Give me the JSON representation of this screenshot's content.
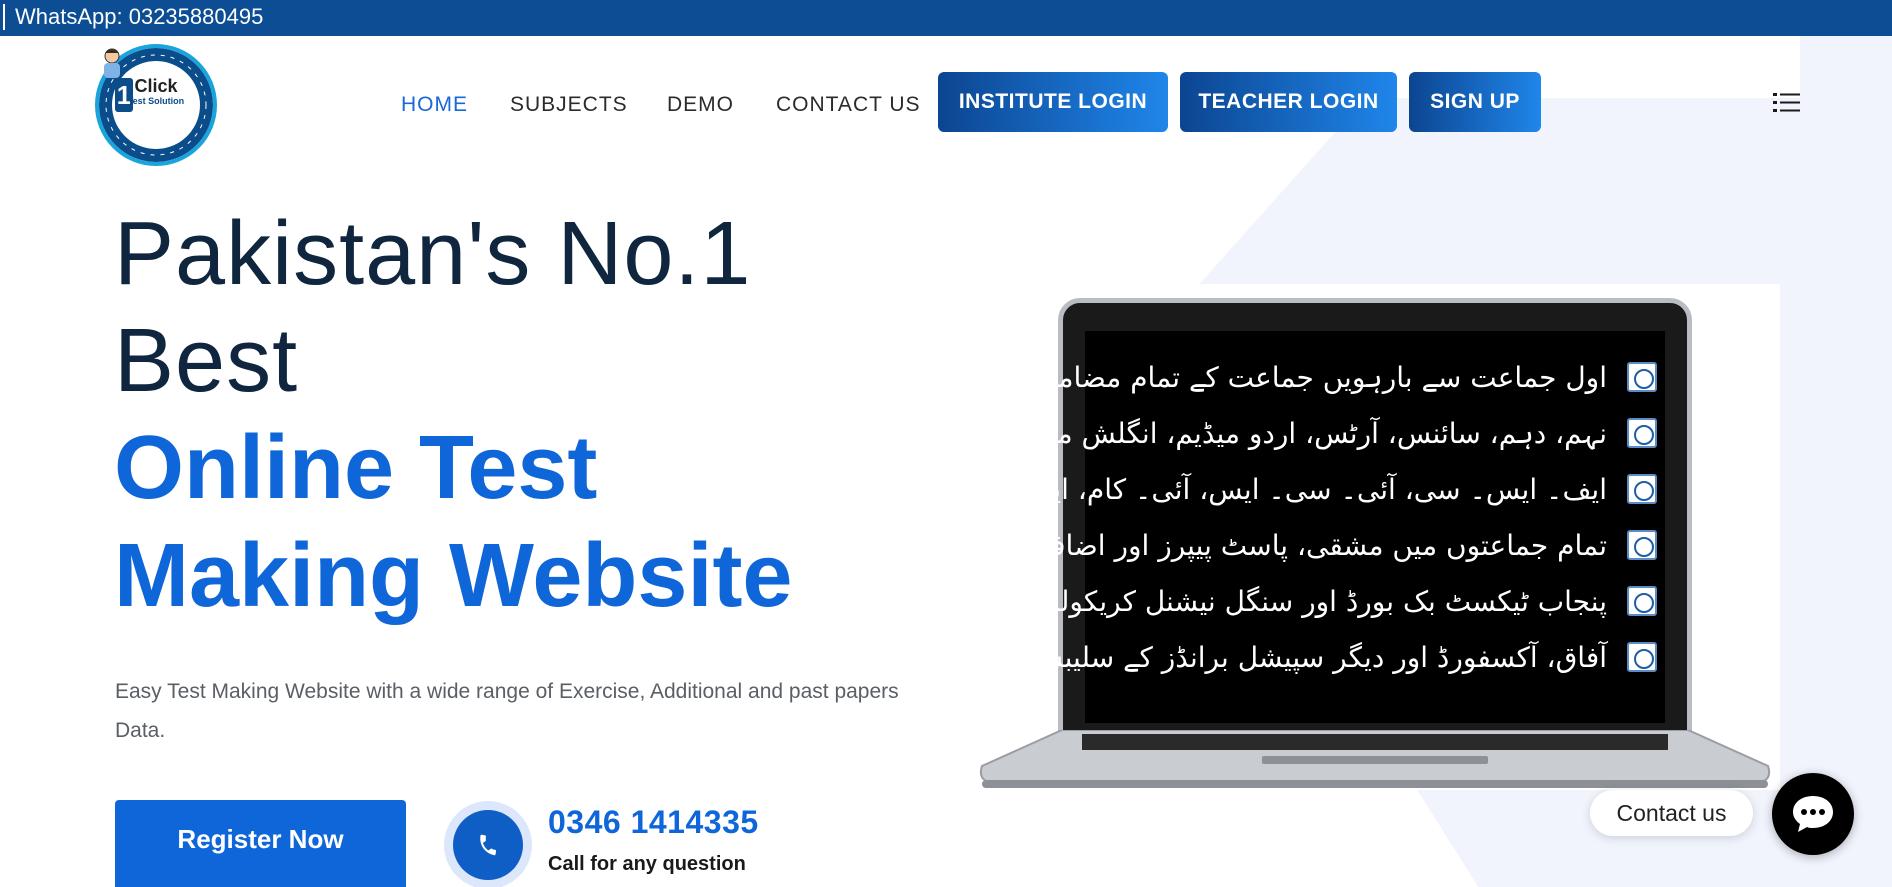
{
  "topbar": {
    "whatsapp": "WhatsApp: 03235880495"
  },
  "logo": {
    "click": "Click",
    "sub": "Test Solution",
    "one": "1"
  },
  "nav": {
    "home": "HOME",
    "subjects": "SUBJECTS",
    "demo": "DEMO",
    "contact": "CONTACT US",
    "institute_login": "INSTITUTE LOGIN",
    "teacher_login": "TEACHER LOGIN",
    "signup": "SIGN UP"
  },
  "hero": {
    "line1": "Pakistan's No.1",
    "line2": "Best",
    "line3": "Online Test",
    "line4": "Making Website",
    "description": "Easy Test Making Website with a wide range of Exercise, Additional and past papers Data.",
    "register": "Register Now",
    "phone": "0346 1414335",
    "phone_caption": "Call for any question"
  },
  "screen": {
    "rows": [
      "اول جماعت سے بارہویں جماعت کے تمام مضامین",
      "نہم، دہم، سائنس، آرٹس، اردو میڈیم، انگلش میڈیم",
      "ایف۔ ایس۔ سی، آئی۔ سی۔ ایس، آئی۔ کام، ایف۔ اے",
      "تمام جماعتوں میں مشقی، پاسٹ پیپرز اور اضافی سوالات",
      "پنجاب ٹیکسٹ بک بورڈ اور سنگل نیشنل کریکولم کے عین مطابق",
      "آفاق، آکسفورڈ اور دیگر سپیشل برانڈز کے سلیبس کے مطابق"
    ]
  },
  "contact_widget": {
    "label": "Contact us"
  },
  "colors": {
    "topbar": "#0d4d94",
    "accent": "#0f66d8",
    "heading": "#10263f"
  },
  "icons": {
    "menu": "list-icon",
    "phone": "phone-icon",
    "chat": "chat-bubble-icon"
  }
}
